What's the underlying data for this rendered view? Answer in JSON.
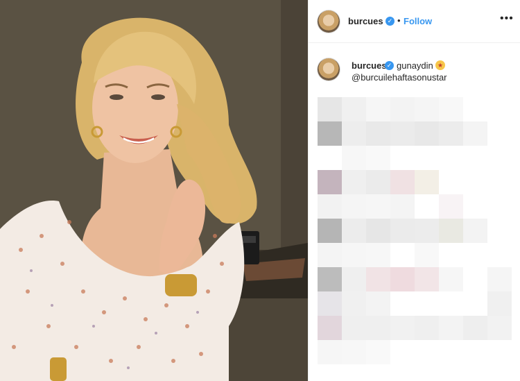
{
  "post": {
    "username": "burcues",
    "follow_label": "Follow",
    "separator": "•",
    "more_label": "•••",
    "caption_text": "gunaydin",
    "caption_emoji": "star-struck-emoji",
    "caption_mention": "@burcuilehaftasonustar"
  },
  "icons": {
    "verified": "verified-badge-icon",
    "more": "more-options-icon"
  },
  "colors": {
    "accent": "#3897f0",
    "text": "#262626",
    "divider": "#efefef"
  }
}
